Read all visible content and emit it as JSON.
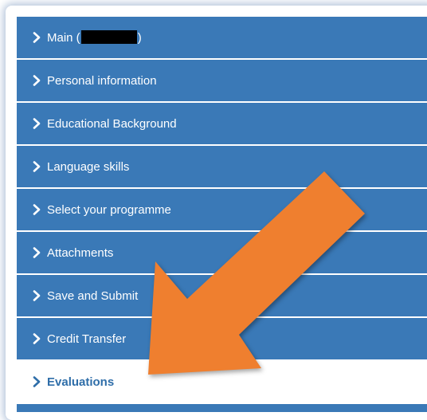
{
  "menu": {
    "items": [
      {
        "label_prefix": "Main (",
        "label_suffix": ")"
      },
      {
        "label": "Personal information"
      },
      {
        "label": "Educational Background"
      },
      {
        "label": "Language skills"
      },
      {
        "label": "Select your programme"
      },
      {
        "label": "Attachments"
      },
      {
        "label": "Save and Submit"
      },
      {
        "label": "Credit Transfer"
      },
      {
        "label": "Evaluations"
      }
    ],
    "active_item": "Evaluations"
  },
  "colors": {
    "menu_bg": "#3a79b7",
    "menu_text": "#ffffff",
    "active_bg": "#ffffff",
    "active_text": "#2f6ea9",
    "arrow": "#ef7f2f"
  },
  "icons": {
    "menu_item": "chevron-right-icon",
    "annotation": "arrow-annotation"
  }
}
